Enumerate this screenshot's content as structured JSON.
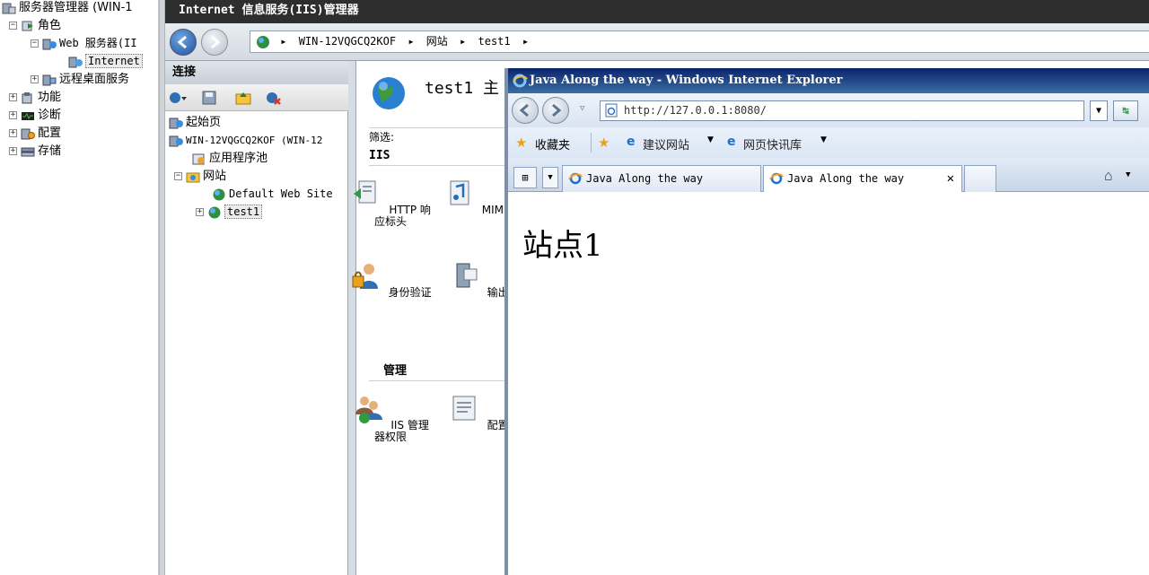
{
  "server_manager": {
    "root": "服务器管理器 (WIN-1",
    "roles": "角色",
    "web_server": "Web 服务器(II",
    "iis_node": "Internet",
    "rds": "远程桌面服务",
    "features": "功能",
    "diagnostics": "诊断",
    "configuration": "配置",
    "storage": "存储"
  },
  "iis": {
    "title": "Internet 信息服务(IIS)管理器",
    "breadcrumb": [
      "WIN-12VQGCQ2KOF",
      "网站",
      "test1"
    ],
    "connections": {
      "header": "连接",
      "tree": {
        "start_page": "起始页",
        "server": "WIN-12VQGCQ2KOF (WIN-12",
        "app_pools": "应用程序池",
        "sites": "网站",
        "default_site": "Default Web Site",
        "test1": "test1"
      }
    },
    "features": {
      "page_title": "test1 主",
      "filter_label": "筛选:",
      "section_iis": "IIS",
      "section_manage": "管理",
      "http_headers": "HTTP 响应标头",
      "mime": "MIME 类",
      "auth": "身份验证",
      "output": "输出缓",
      "iis_permissions": "IIS 管理器权限",
      "config_editor": "配置编"
    }
  },
  "ie": {
    "title": "Java Along the way - Windows Internet Explorer",
    "url": "http://127.0.0.1:8080/",
    "favorites": "收藏夹",
    "suggested_sites": "建议网站",
    "web_slices": "网页快讯库",
    "tabs": [
      "Java Along the way",
      "Java Along the way"
    ],
    "page_heading": "站点1"
  }
}
